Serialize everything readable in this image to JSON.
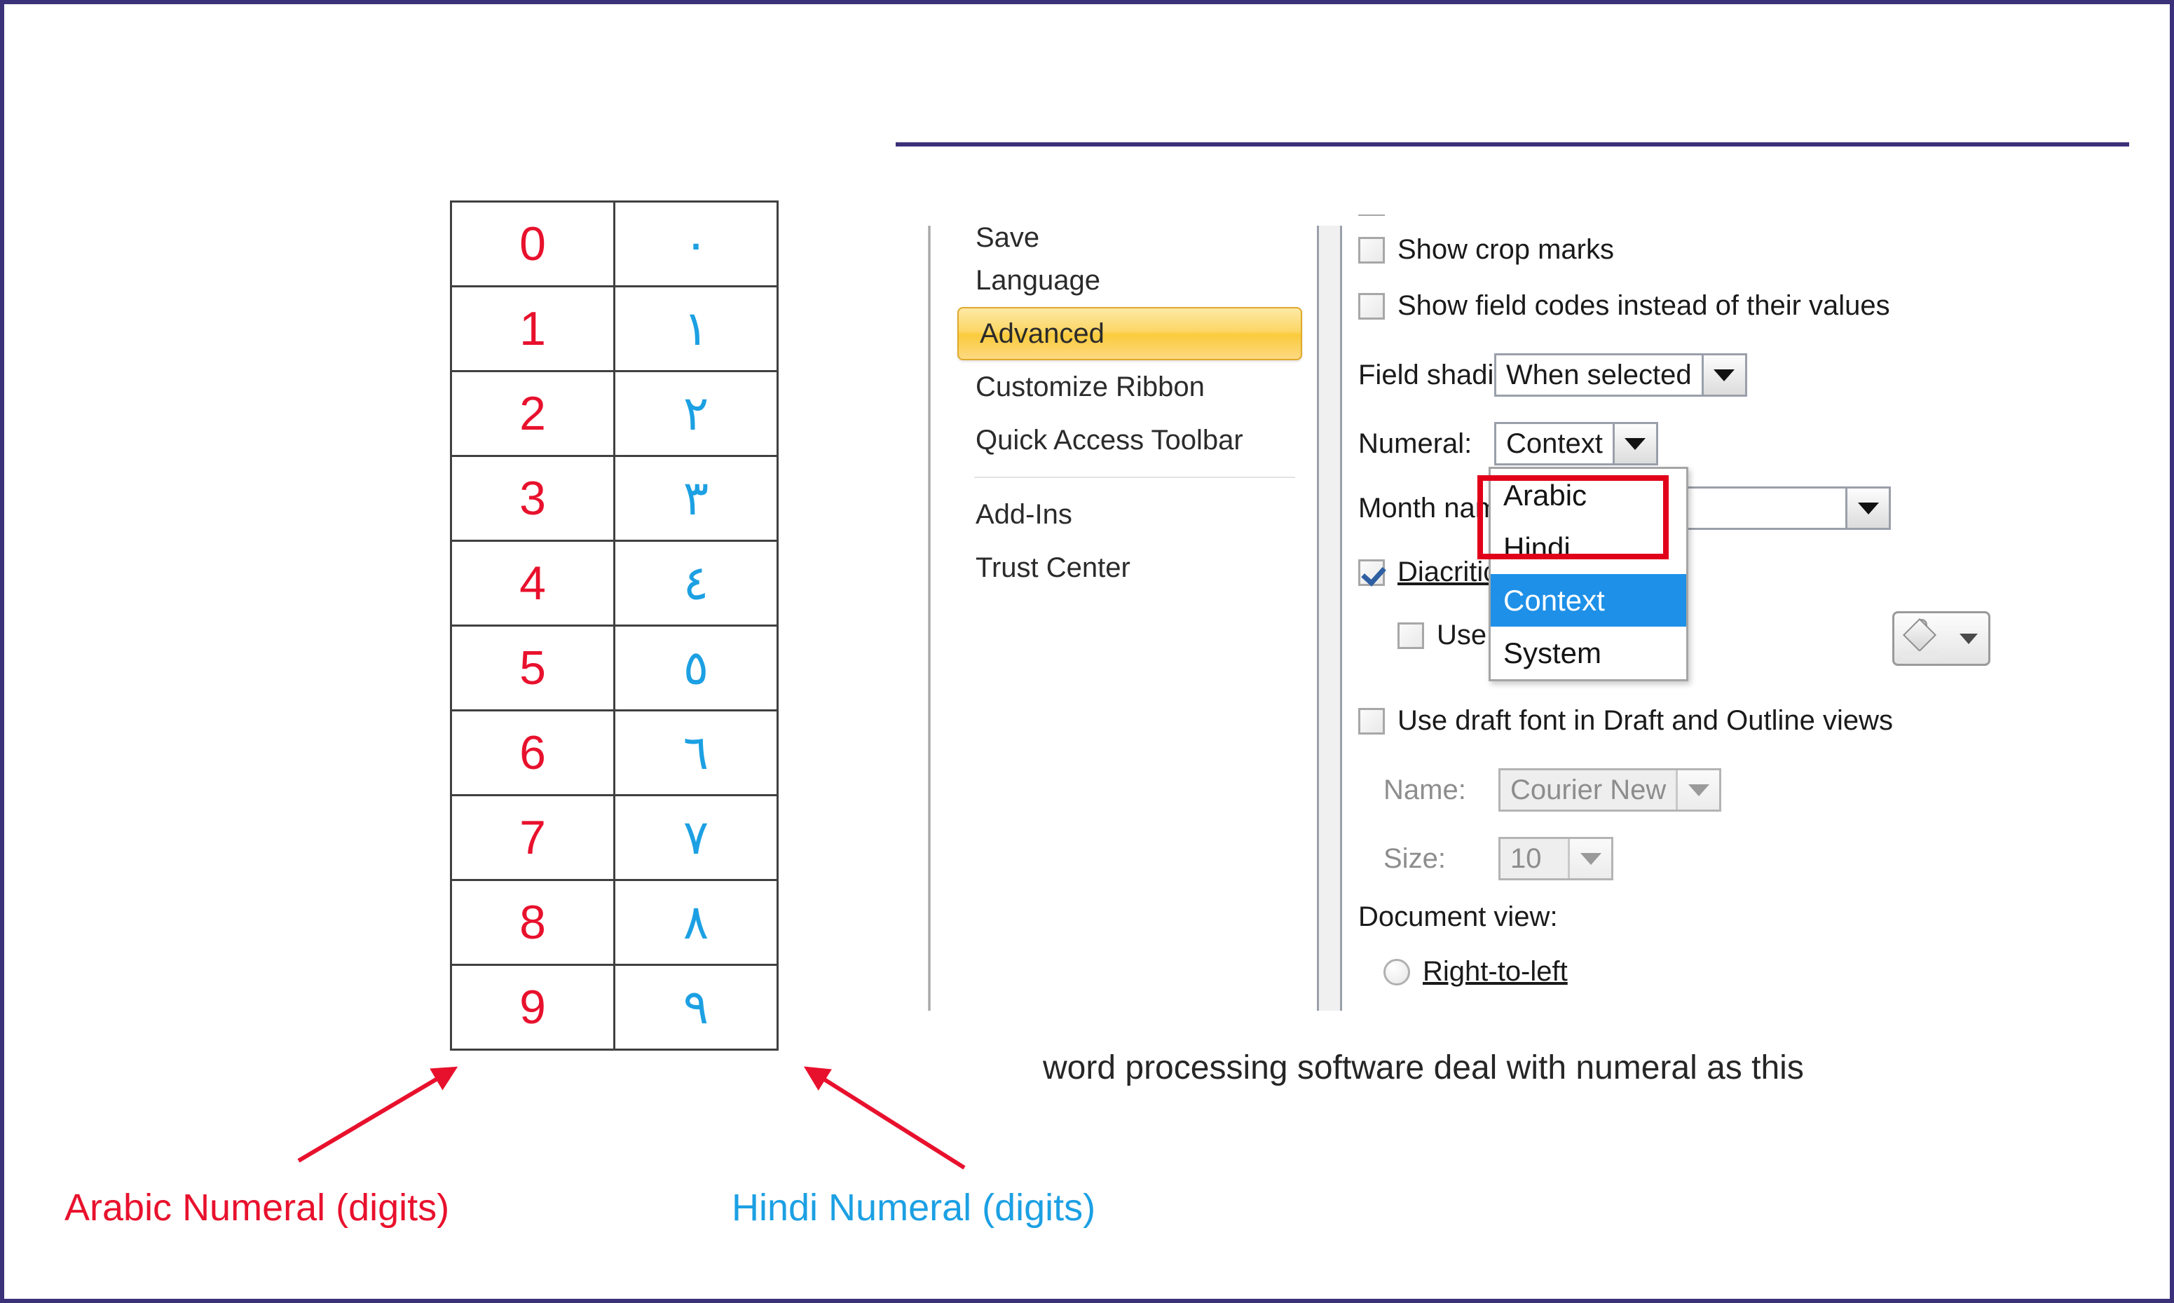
{
  "slide": {
    "border_color": "#3b3179",
    "rule_color": "#3b3179"
  },
  "numeral_table": {
    "arabic_color": "#e8112d",
    "hindi_color": "#1CA0E3",
    "rows": [
      {
        "arabic": "0",
        "hindi": "٠"
      },
      {
        "arabic": "1",
        "hindi": "١"
      },
      {
        "arabic": "2",
        "hindi": "٢"
      },
      {
        "arabic": "3",
        "hindi": "٣"
      },
      {
        "arabic": "4",
        "hindi": "٤"
      },
      {
        "arabic": "5",
        "hindi": "٥"
      },
      {
        "arabic": "6",
        "hindi": "٦"
      },
      {
        "arabic": "7",
        "hindi": "٧"
      },
      {
        "arabic": "8",
        "hindi": "٨"
      },
      {
        "arabic": "9",
        "hindi": "٩"
      }
    ]
  },
  "captions": {
    "arabic": "Arabic Numeral (digits)",
    "hindi": "Hindi Numeral (digits)",
    "note": "word processing software deal with numeral as this"
  },
  "dialog": {
    "sidebar": {
      "items": [
        {
          "label": "Save",
          "selected": false,
          "clipped": true
        },
        {
          "label": "Language",
          "selected": false
        },
        {
          "label": "Advanced",
          "selected": true
        },
        {
          "label": "Customize Ribbon",
          "selected": false
        },
        {
          "label": "Quick Access Toolbar",
          "selected": false
        },
        {
          "label": "Add-Ins",
          "selected": false
        },
        {
          "label": "Trust Center",
          "selected": false
        }
      ]
    },
    "options": {
      "show_crop_marks": "Show crop marks",
      "show_field_codes": "Show field codes instead of their values",
      "field_shading_label": "Field shading:",
      "field_shading_value": "When selected",
      "numeral_label": "Numeral:",
      "numeral_value": "Context",
      "month_names_label": "Month names:",
      "month_names_value": "",
      "diacritics": "Diacritics",
      "use_this_diacritics": "Use this ... ritics",
      "use_draft_font": "Use draft font in Draft and Outline views",
      "name_label": "Name:",
      "name_value": "Courier New",
      "size_label": "Size:",
      "size_value": "10",
      "document_view_label": "Document view:",
      "right_to_left": "Right-to-left"
    },
    "numeral_dropdown": {
      "items": [
        "Arabic",
        "Hindi",
        "Context",
        "System"
      ],
      "highlighted": "Context",
      "highlight_color": "#1E90E8",
      "annotation_box_color": "#E1001A"
    },
    "selected_nav_color": "#fbcb3c"
  }
}
